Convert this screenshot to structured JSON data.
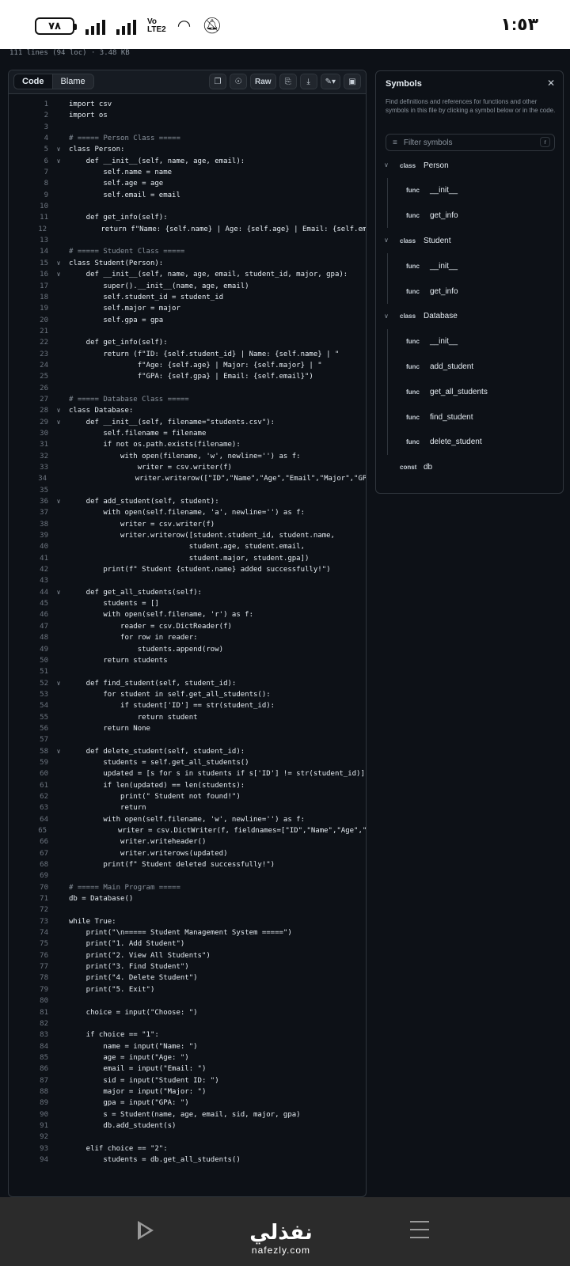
{
  "statusbar": {
    "battery": "٧٨",
    "volte": "Vo\nLTE2",
    "time": "١:٥٣"
  },
  "file_info": "111 lines (94 loc) · 3.48 KB",
  "toolbar": {
    "code_tab": "Code",
    "blame_tab": "Blame",
    "raw_label": "Raw"
  },
  "code_lines": [
    {
      "n": "1",
      "fold": "",
      "t": "import csv"
    },
    {
      "n": "2",
      "fold": "",
      "t": "import os"
    },
    {
      "n": "3",
      "fold": "",
      "t": ""
    },
    {
      "n": "4",
      "fold": "",
      "t": "# ===== Person Class ====="
    },
    {
      "n": "5",
      "fold": "v",
      "t": "class Person:"
    },
    {
      "n": "6",
      "fold": "v",
      "t": "    def __init__(self, name, age, email):"
    },
    {
      "n": "7",
      "fold": "",
      "t": "        self.name = name"
    },
    {
      "n": "8",
      "fold": "",
      "t": "        self.age = age"
    },
    {
      "n": "9",
      "fold": "",
      "t": "        self.email = email"
    },
    {
      "n": "10",
      "fold": "",
      "t": ""
    },
    {
      "n": "11",
      "fold": "",
      "t": "    def get_info(self):"
    },
    {
      "n": "12",
      "fold": "",
      "t": "        return f\"Name: {self.name} | Age: {self.age} | Email: {self.email"
    },
    {
      "n": "13",
      "fold": "",
      "t": ""
    },
    {
      "n": "14",
      "fold": "",
      "t": "# ===== Student Class ====="
    },
    {
      "n": "15",
      "fold": "v",
      "t": "class Student(Person):"
    },
    {
      "n": "16",
      "fold": "v",
      "t": "    def __init__(self, name, age, email, student_id, major, gpa):"
    },
    {
      "n": "17",
      "fold": "",
      "t": "        super().__init__(name, age, email)"
    },
    {
      "n": "18",
      "fold": "",
      "t": "        self.student_id = student_id"
    },
    {
      "n": "19",
      "fold": "",
      "t": "        self.major = major"
    },
    {
      "n": "20",
      "fold": "",
      "t": "        self.gpa = gpa"
    },
    {
      "n": "21",
      "fold": "",
      "t": ""
    },
    {
      "n": "22",
      "fold": "",
      "t": "    def get_info(self):"
    },
    {
      "n": "23",
      "fold": "",
      "t": "        return (f\"ID: {self.student_id} | Name: {self.name} | \""
    },
    {
      "n": "24",
      "fold": "",
      "t": "                f\"Age: {self.age} | Major: {self.major} | \""
    },
    {
      "n": "25",
      "fold": "",
      "t": "                f\"GPA: {self.gpa} | Email: {self.email}\")"
    },
    {
      "n": "26",
      "fold": "",
      "t": ""
    },
    {
      "n": "27",
      "fold": "",
      "t": "# ===== Database Class ====="
    },
    {
      "n": "28",
      "fold": "v",
      "t": "class Database:"
    },
    {
      "n": "29",
      "fold": "v",
      "t": "    def __init__(self, filename=\"students.csv\"):"
    },
    {
      "n": "30",
      "fold": "",
      "t": "        self.filename = filename"
    },
    {
      "n": "31",
      "fold": "",
      "t": "        if not os.path.exists(filename):"
    },
    {
      "n": "32",
      "fold": "",
      "t": "            with open(filename, 'w', newline='') as f:"
    },
    {
      "n": "33",
      "fold": "",
      "t": "                writer = csv.writer(f)"
    },
    {
      "n": "34",
      "fold": "",
      "t": "                writer.writerow([\"ID\",\"Name\",\"Age\",\"Email\",\"Major\",\"GPA\"]"
    },
    {
      "n": "35",
      "fold": "",
      "t": ""
    },
    {
      "n": "36",
      "fold": "v",
      "t": "    def add_student(self, student):"
    },
    {
      "n": "37",
      "fold": "",
      "t": "        with open(self.filename, 'a', newline='') as f:"
    },
    {
      "n": "38",
      "fold": "",
      "t": "            writer = csv.writer(f)"
    },
    {
      "n": "39",
      "fold": "",
      "t": "            writer.writerow([student.student_id, student.name,"
    },
    {
      "n": "40",
      "fold": "",
      "t": "                            student.age, student.email,"
    },
    {
      "n": "41",
      "fold": "",
      "t": "                            student.major, student.gpa])"
    },
    {
      "n": "42",
      "fold": "",
      "t": "        print(f\" Student {student.name} added successfully!\")"
    },
    {
      "n": "43",
      "fold": "",
      "t": ""
    },
    {
      "n": "44",
      "fold": "v",
      "t": "    def get_all_students(self):"
    },
    {
      "n": "45",
      "fold": "",
      "t": "        students = []"
    },
    {
      "n": "46",
      "fold": "",
      "t": "        with open(self.filename, 'r') as f:"
    },
    {
      "n": "47",
      "fold": "",
      "t": "            reader = csv.DictReader(f)"
    },
    {
      "n": "48",
      "fold": "",
      "t": "            for row in reader:"
    },
    {
      "n": "49",
      "fold": "",
      "t": "                students.append(row)"
    },
    {
      "n": "50",
      "fold": "",
      "t": "        return students"
    },
    {
      "n": "51",
      "fold": "",
      "t": ""
    },
    {
      "n": "52",
      "fold": "v",
      "t": "    def find_student(self, student_id):"
    },
    {
      "n": "53",
      "fold": "",
      "t": "        for student in self.get_all_students():"
    },
    {
      "n": "54",
      "fold": "",
      "t": "            if student['ID'] == str(student_id):"
    },
    {
      "n": "55",
      "fold": "",
      "t": "                return student"
    },
    {
      "n": "56",
      "fold": "",
      "t": "        return None"
    },
    {
      "n": "57",
      "fold": "",
      "t": ""
    },
    {
      "n": "58",
      "fold": "v",
      "t": "    def delete_student(self, student_id):"
    },
    {
      "n": "59",
      "fold": "",
      "t": "        students = self.get_all_students()"
    },
    {
      "n": "60",
      "fold": "",
      "t": "        updated = [s for s in students if s['ID'] != str(student_id)]"
    },
    {
      "n": "61",
      "fold": "",
      "t": "        if len(updated) == len(students):"
    },
    {
      "n": "62",
      "fold": "",
      "t": "            print(\" Student not found!\")"
    },
    {
      "n": "63",
      "fold": "",
      "t": "            return"
    },
    {
      "n": "64",
      "fold": "",
      "t": "        with open(self.filename, 'w', newline='') as f:"
    },
    {
      "n": "65",
      "fold": "",
      "t": "            writer = csv.DictWriter(f, fieldnames=[\"ID\",\"Name\",\"Age\",\"Ema"
    },
    {
      "n": "66",
      "fold": "",
      "t": "            writer.writeheader()"
    },
    {
      "n": "67",
      "fold": "",
      "t": "            writer.writerows(updated)"
    },
    {
      "n": "68",
      "fold": "",
      "t": "        print(f\" Student deleted successfully!\")"
    },
    {
      "n": "69",
      "fold": "",
      "t": ""
    },
    {
      "n": "70",
      "fold": "",
      "t": "# ===== Main Program ====="
    },
    {
      "n": "71",
      "fold": "",
      "t": "db = Database()"
    },
    {
      "n": "72",
      "fold": "",
      "t": ""
    },
    {
      "n": "73",
      "fold": "",
      "t": "while True:"
    },
    {
      "n": "74",
      "fold": "",
      "t": "    print(\"\\n===== Student Management System =====\")"
    },
    {
      "n": "75",
      "fold": "",
      "t": "    print(\"1. Add Student\")"
    },
    {
      "n": "76",
      "fold": "",
      "t": "    print(\"2. View All Students\")"
    },
    {
      "n": "77",
      "fold": "",
      "t": "    print(\"3. Find Student\")"
    },
    {
      "n": "78",
      "fold": "",
      "t": "    print(\"4. Delete Student\")"
    },
    {
      "n": "79",
      "fold": "",
      "t": "    print(\"5. Exit\")"
    },
    {
      "n": "80",
      "fold": "",
      "t": ""
    },
    {
      "n": "81",
      "fold": "",
      "t": "    choice = input(\"Choose: \")"
    },
    {
      "n": "82",
      "fold": "",
      "t": ""
    },
    {
      "n": "83",
      "fold": "",
      "t": "    if choice == \"1\":"
    },
    {
      "n": "84",
      "fold": "",
      "t": "        name = input(\"Name: \")"
    },
    {
      "n": "85",
      "fold": "",
      "t": "        age = input(\"Age: \")"
    },
    {
      "n": "86",
      "fold": "",
      "t": "        email = input(\"Email: \")"
    },
    {
      "n": "87",
      "fold": "",
      "t": "        sid = input(\"Student ID: \")"
    },
    {
      "n": "88",
      "fold": "",
      "t": "        major = input(\"Major: \")"
    },
    {
      "n": "89",
      "fold": "",
      "t": "        gpa = input(\"GPA: \")"
    },
    {
      "n": "90",
      "fold": "",
      "t": "        s = Student(name, age, email, sid, major, gpa)"
    },
    {
      "n": "91",
      "fold": "",
      "t": "        db.add_student(s)"
    },
    {
      "n": "92",
      "fold": "",
      "t": ""
    },
    {
      "n": "93",
      "fold": "",
      "t": "    elif choice == \"2\":"
    },
    {
      "n": "94",
      "fold": "",
      "t": "        students = db.get_all_students()"
    }
  ],
  "symbols": {
    "title": "Symbols",
    "description": "Find definitions and references for functions and other symbols in this file by clicking a symbol below or in the code.",
    "filter_placeholder": "Filter symbols",
    "filter_key": "r",
    "items": [
      {
        "kind": "class",
        "name": "Person",
        "depth": 0
      },
      {
        "kind": "func",
        "name": "__init__",
        "depth": 1
      },
      {
        "kind": "func",
        "name": "get_info",
        "depth": 1
      },
      {
        "kind": "class",
        "name": "Student",
        "depth": 0
      },
      {
        "kind": "func",
        "name": "__init__",
        "depth": 1
      },
      {
        "kind": "func",
        "name": "get_info",
        "depth": 1
      },
      {
        "kind": "class",
        "name": "Database",
        "depth": 0
      },
      {
        "kind": "func",
        "name": "__init__",
        "depth": 1
      },
      {
        "kind": "func",
        "name": "add_student",
        "depth": 1
      },
      {
        "kind": "func",
        "name": "get_all_students",
        "depth": 1
      },
      {
        "kind": "func",
        "name": "find_student",
        "depth": 1
      },
      {
        "kind": "func",
        "name": "delete_student",
        "depth": 1
      },
      {
        "kind": "const",
        "name": "db",
        "depth": 0
      }
    ]
  },
  "bottom_nav": {
    "logo_arabic": "نفذلي",
    "logo_latin": "nafezly.com"
  }
}
